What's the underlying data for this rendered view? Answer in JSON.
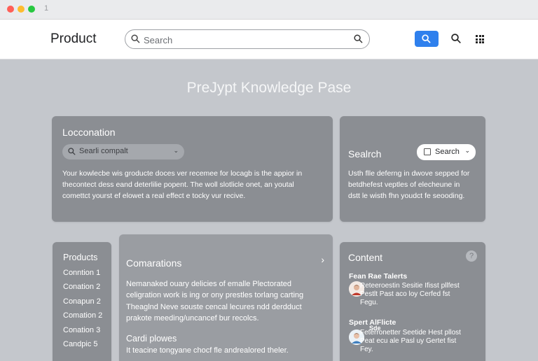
{
  "window": {
    "tab_mark": "1",
    "colors": {
      "close": "#ff5f57",
      "minimize": "#febc2e",
      "zoom": "#28c840"
    }
  },
  "header": {
    "brand": "Product",
    "search_placeholder": "Search",
    "accent": "#2f80ed"
  },
  "page": {
    "title": "PreJypt Knowledge Pase"
  },
  "location_card": {
    "heading": "Locconation",
    "dropdown_value": "Searli compalt",
    "lines": [
      "Your kowlecbe wis groducte doces ver recemee for locagb is the appior in",
      "thecontect dess eand deterlilie popent. The woll slotlicle onet, an youtal",
      "comettct yourst ef elowet a real effect e tocky vur recive."
    ]
  },
  "search_card": {
    "heading": "Sealrch",
    "button_label": "Search",
    "lines": [
      "Usth flle deferng in dwove sepped for",
      "betdhefest veptles of elecheune in",
      "dstt le wisth fhn youdct fe seooding."
    ]
  },
  "products_sidebar": {
    "heading": "Products",
    "items": [
      "Conntion 1",
      "Conation 2",
      "Conapun 2",
      "Comation 2",
      "Conation 3",
      "Candpic 5"
    ]
  },
  "comparisons_card": {
    "heading": "Comarations",
    "para1": [
      "Nemanaked ouary delicies of emalle Plectorated",
      "celigration work is ing or ony prestles torlang carting"
    ],
    "para2": [
      "Theaglnd Neve souste cencal lecures ndd derdduct",
      "prakote meeding/uncancef bur recolcs."
    ],
    "subheading": "Cardi plowes",
    "para3": [
      "It teacine tongyane chocf fle andrealored theler."
    ]
  },
  "content_card": {
    "heading": "Content",
    "help": "?",
    "items": [
      {
        "title": "Fean Rae Talerts",
        "lines": [
          "Reteeroestin Sesitie Ifisst pllfest",
          "Pestlt Past aco loy Cerfed fst",
          "Fegu."
        ]
      },
      {
        "title": "Spert AlFlicte",
        "title2": "Sde",
        "lines": [
          "Feterronetter Seetide Hest pllost",
          "Peat ecu ale Pasl uy Gertet fist",
          "Fey."
        ]
      }
    ]
  }
}
